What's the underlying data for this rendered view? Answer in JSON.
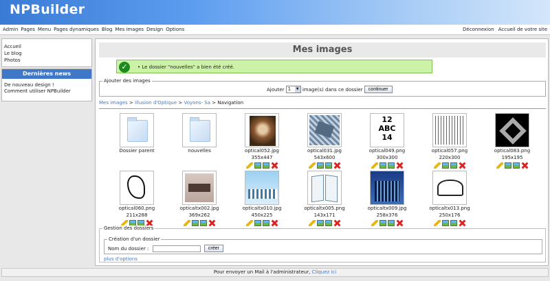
{
  "header": {
    "app_name": "NPBuilder"
  },
  "menu": {
    "left": [
      "Admin",
      "Pages",
      "Menu",
      "Pages dynamiques",
      "Blog",
      "Mes images",
      "Design",
      "Options"
    ],
    "right": [
      "Déconnexion",
      "Accueil de votre site"
    ]
  },
  "sidebar": {
    "links": [
      "Accueil",
      "Le blog",
      "Photos"
    ],
    "news_title": "Dernières news",
    "news": [
      "De nouveau design !",
      "Comment utiliser NPBuilder"
    ]
  },
  "main": {
    "title": "Mes images",
    "success": "Le dossier \"nouvelles\" a bien été créé.",
    "add_legend": "Ajouter des images",
    "add_label": "Ajouter",
    "add_count": "1",
    "add_suffix": "image(s) dans ce dossier",
    "add_button": "continuer",
    "breadcrumb": [
      {
        "label": "Mes images",
        "link": true
      },
      {
        "label": ">",
        "link": false
      },
      {
        "label": "Illusion d'Optique",
        "link": true
      },
      {
        "label": ">",
        "link": false
      },
      {
        "label": "Voyons- Sa",
        "link": true
      },
      {
        "label": ">",
        "link": false
      },
      {
        "label": "Navigation",
        "link": false
      }
    ],
    "folders": [
      {
        "name": "Dossier parent"
      },
      {
        "name": "nouvelles"
      }
    ],
    "images": [
      {
        "name": "optical052.jpg",
        "size": "355x447"
      },
      {
        "name": "optical031.jpg",
        "size": "543x600"
      },
      {
        "name": "optical049.png",
        "size": "300x300"
      },
      {
        "name": "optical057.png",
        "size": "220x300"
      },
      {
        "name": "optical083.png",
        "size": "195x195"
      },
      {
        "name": "optical060.png",
        "size": "211x288"
      },
      {
        "name": "opticaltx002.jpg",
        "size": "369x262"
      },
      {
        "name": "opticaltx010.jpg",
        "size": "450x225"
      },
      {
        "name": "opticaltx005.png",
        "size": "143x171"
      },
      {
        "name": "opticaltx009.jpg",
        "size": "258x376"
      },
      {
        "name": "opticaltx013.png",
        "size": "250x176"
      }
    ],
    "abc_text": [
      "12",
      "ABC",
      "14"
    ],
    "folders_legend": "Gestion des dossiers",
    "create_legend": "Création d'un dossier",
    "folder_name_label": "Nom du dossier :",
    "create_button": "créer",
    "more_options": "plus d'options"
  },
  "footer": {
    "text": "Pour envoyer un Mail à l'administrateur,",
    "link": "Cliquez ici"
  },
  "colors": {
    "header": "#3a7bd5",
    "success_bg": "#ccf2a8",
    "link": "#4a78c0",
    "news_title": "#3f78c8"
  }
}
